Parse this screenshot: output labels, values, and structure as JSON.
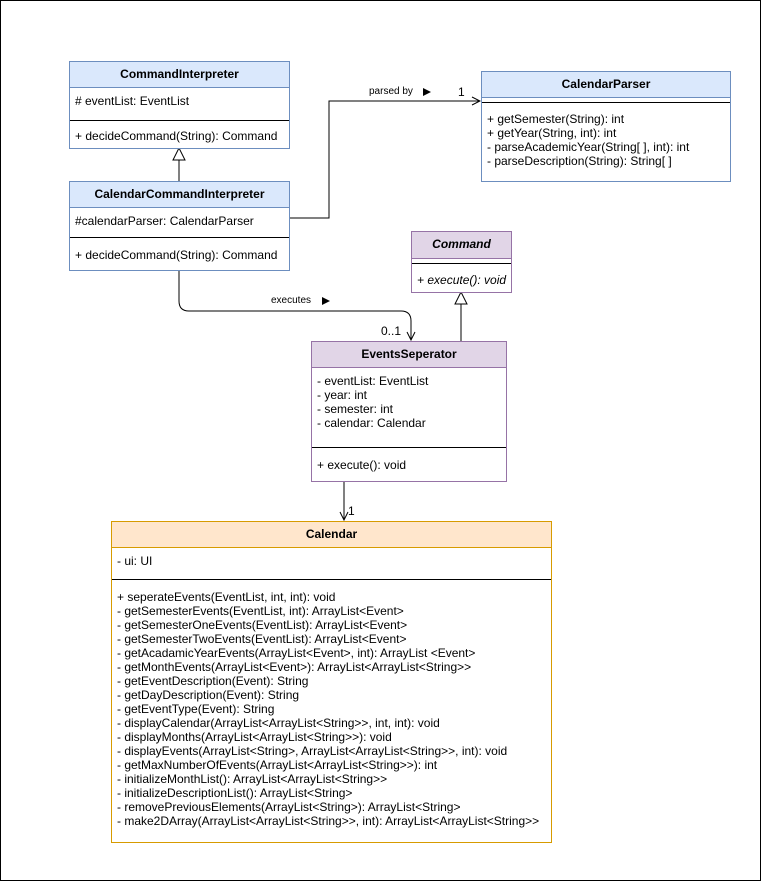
{
  "classes": {
    "command_interpreter": {
      "name": "CommandInterpreter",
      "attributes": [
        "# eventList: EventList"
      ],
      "methods": [
        "+ decideCommand(String): Command"
      ]
    },
    "calendar_command_interpreter": {
      "name": "CalendarCommandInterpreter",
      "attributes": [
        "#calendarParser: CalendarParser"
      ],
      "methods": [
        "+ decideCommand(String): Command"
      ]
    },
    "calendar_parser": {
      "name": "CalendarParser",
      "attributes": [],
      "methods": [
        "+ getSemester(String): int",
        "+ getYear(String, int): int",
        "- parseAcademicYear(String[ ], int): int",
        "- parseDescription(String): String[ ]"
      ]
    },
    "command": {
      "name": "Command",
      "attributes": [],
      "methods": [
        "+ execute(): void"
      ]
    },
    "events_seperator": {
      "name": "EventsSeperator",
      "attributes": [
        "- eventList: EventList",
        "- year: int",
        "- semester: int",
        "- calendar: Calendar"
      ],
      "methods": [
        "+ execute(): void"
      ]
    },
    "calendar": {
      "name": "Calendar",
      "attributes": [
        "- ui: UI"
      ],
      "methods": [
        "+ seperateEvents(EventList, int, int): void",
        "- getSemesterEvents(EventList, int): ArrayList<Event>",
        "- getSemesterOneEvents(EventList): ArrayList<Event>",
        "- getSemesterTwoEvents(EventList): ArrayList<Event>",
        "- getAcadamicYearEvents(ArrayList<Event>, int): ArrayList <Event>",
        "- getMonthEvents(ArrayList<Event>): ArrayList<ArrayList<String>>",
        "- getEventDescription(Event): String",
        "- getDayDescription(Event): String",
        "- getEventType(Event): String",
        "- displayCalendar(ArrayList<ArrayList<String>>, int, int): void",
        "- displayMonths(ArrayList<ArrayList<String>>): void",
        "- displayEvents(ArrayList<String>, ArrayList<ArrayList<String>>, int): void",
        "- getMaxNumberOfEvents(ArrayList<ArrayList<String>>): int",
        "- initializeMonthList(): ArrayList<ArrayList<String>>",
        "- initializeDescriptionList(): ArrayList<String>",
        "- removePreviousElements(ArrayList<String>): ArrayList<String>",
        "- make2DArray(ArrayList<ArrayList<String>>, int): ArrayList<ArrayList<String>>"
      ]
    }
  },
  "relations": {
    "parsed_by": {
      "label": "parsed by",
      "multiplicity": "1"
    },
    "executes": {
      "label": "executes",
      "multiplicity": "0..1"
    },
    "calendar_assoc": {
      "multiplicity": "1"
    }
  },
  "colors": {
    "blue_fill": "#dae8fc",
    "blue_stroke": "#6c8ebf",
    "purple_fill": "#e1d5e7",
    "purple_stroke": "#9673a6",
    "orange_fill": "#ffe6cc",
    "orange_stroke": "#d79b00"
  }
}
